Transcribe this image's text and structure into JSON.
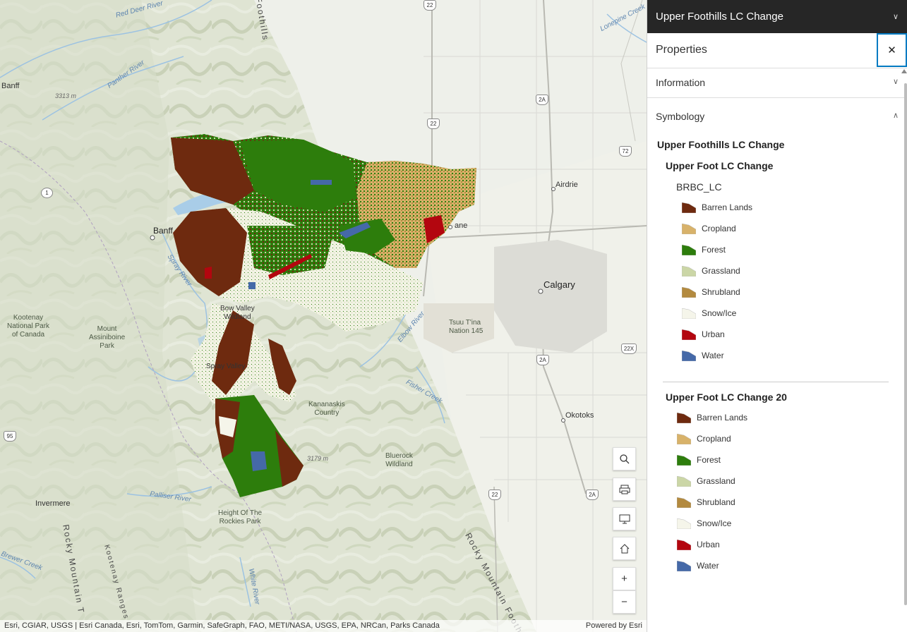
{
  "map": {
    "places": {
      "banff": "Banff",
      "banff_nw": "Banff",
      "airdrie": "Airdrie",
      "calgary": "Calgary",
      "cochrane": "ane",
      "okotoks": "Okotoks",
      "invermere": "Invermere",
      "tsuu_tina": "Tsuu T'ina\nNation 145",
      "kootenay": "Kootenay\nNational Park\nof Canada",
      "assiniboine": "Mount\nAssiniboine\nPark",
      "bow_valley": "Bow Valley\nWildland",
      "spray": "Spray Valley",
      "kananaskis": "Kananaskis\nCountry",
      "bluerock": "Bluerock\nWildland",
      "height_rockies": "Height Of The\nRockies Park",
      "red_deer_river": "Red Deer River",
      "panther_river": "Panther River",
      "spray_river": "Spray River",
      "elbow_river": "Elbow River",
      "fisher_creek": "Fisher Creek",
      "palliser_river": "Palliser River",
      "white_river": "White River",
      "brewer_creek": "Brewer Creek",
      "lonepine_creek": "Lonepine Creek",
      "foothills": "Foothills",
      "rocky_mountain_t": "Rocky Mountain T",
      "kootenay_ranges": "Kootenay Ranges",
      "rocky_mountain_foothills": "Rocky Mountain Footh",
      "elev1": "3313 m",
      "elev2": "3179 m"
    },
    "shields": {
      "s22a": "22",
      "s22b": "22",
      "s22c": "22",
      "s2a_a": "2A",
      "s2a_b": "2A",
      "s2a_c": "2A",
      "s72": "72",
      "s22x": "22X",
      "s95": "95",
      "s1": "1"
    },
    "attribution": "Esri, CGIAR, USGS | Esri Canada, Esri, TomTom, Garmin, SafeGraph, FAO, METI/NASA, USGS, EPA, NRCan, Parks Canada",
    "powered_by": "Powered by Esri"
  },
  "tools": [
    "search-icon",
    "print-icon",
    "basemap-icon",
    "home-icon",
    "zoom-in-icon",
    "zoom-out-icon"
  ],
  "panel": {
    "layer_title": "Upper Foothills LC Change",
    "properties_label": "Properties",
    "close_glyph": "✕",
    "sections": {
      "information": "Information",
      "symbology": "Symbology"
    },
    "legend": {
      "title": "Upper Foothills LC Change",
      "layer1": {
        "name": "Upper Foot LC Change",
        "field": "BRBC_LC",
        "items": [
          {
            "label": "Barren Lands",
            "color": "#6e2a0f"
          },
          {
            "label": "Cropland",
            "color": "#d8b26a"
          },
          {
            "label": "Forest",
            "color": "#2d7d0c"
          },
          {
            "label": "Grassland",
            "color": "#cbd6a6"
          },
          {
            "label": "Shrubland",
            "color": "#b38a3f"
          },
          {
            "label": "Snow/Ice",
            "color": "#f5f5ea"
          },
          {
            "label": "Urban",
            "color": "#b3060f"
          },
          {
            "label": "Water",
            "color": "#4569a8"
          }
        ]
      },
      "layer2": {
        "name": "Upper Foot LC Change 20",
        "items": [
          {
            "label": "Barren Lands",
            "color": "#6e2a0f"
          },
          {
            "label": "Cropland",
            "color": "#d8b26a"
          },
          {
            "label": "Forest",
            "color": "#2d7d0c"
          },
          {
            "label": "Grassland",
            "color": "#cbd6a6"
          },
          {
            "label": "Shrubland",
            "color": "#b38a3f"
          },
          {
            "label": "Snow/Ice",
            "color": "#f5f5ea"
          },
          {
            "label": "Urban",
            "color": "#b3060f"
          },
          {
            "label": "Water",
            "color": "#4569a8"
          }
        ]
      }
    }
  }
}
